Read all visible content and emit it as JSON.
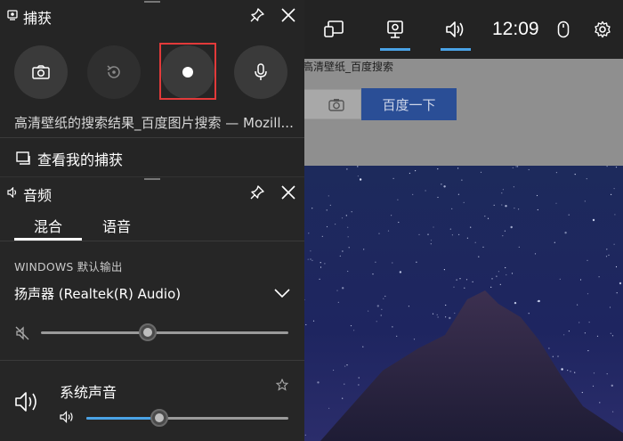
{
  "topbar": {
    "clock": "12:09",
    "icons": [
      "widget-menu-icon",
      "capture-icon",
      "audio-icon",
      "mouse-icon",
      "settings-icon"
    ]
  },
  "browser": {
    "tab_title": "高清壁纸_百度搜索",
    "search_button": "百度一下"
  },
  "capture_panel": {
    "title": "捕获",
    "buttons": [
      "screenshot-icon",
      "record-last-icon",
      "record-start-icon",
      "microphone-icon"
    ],
    "window_title": "高清壁纸的搜索结果_百度图片搜索 — Mozill...",
    "show_captures": "查看我的捕获"
  },
  "audio_panel": {
    "title": "音频",
    "tabs": [
      {
        "label": "混合",
        "active": true
      },
      {
        "label": "语音",
        "active": false
      }
    ],
    "output_section": "WINDOWS 默认输出",
    "output_device": "扬声器 (Realtek(R) Audio)",
    "master_volume": 0.43,
    "master_muted": true,
    "app": {
      "name": "系统声音",
      "volume": 0.36
    }
  },
  "colors": {
    "accent": "#4aa3e6",
    "highlight": "#e23a3a",
    "panel_bg": "#252525"
  }
}
